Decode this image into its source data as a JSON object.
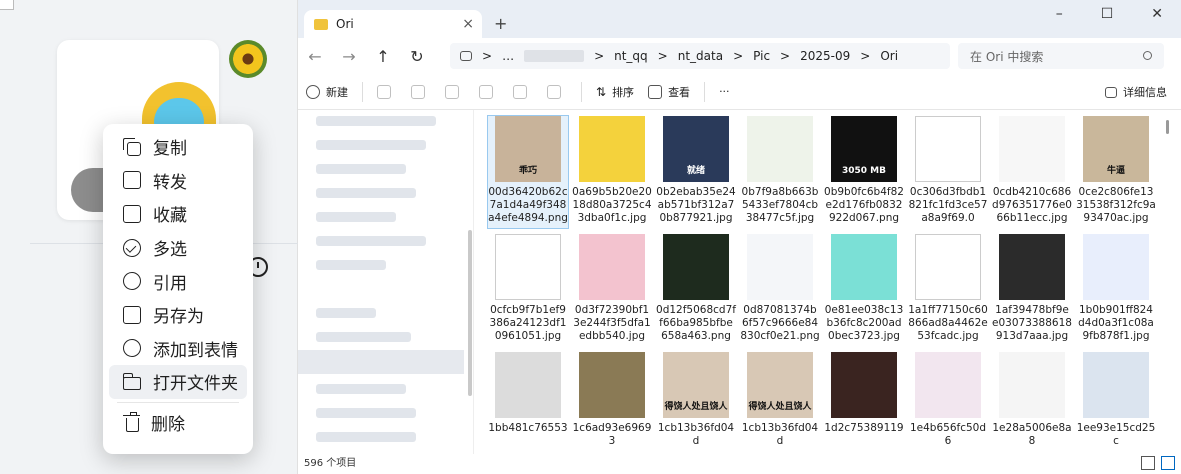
{
  "chat": {
    "menu": [
      {
        "label": "复制",
        "icon": "copy-icon"
      },
      {
        "label": "转发",
        "icon": "forward-icon"
      },
      {
        "label": "收藏",
        "icon": "star-icon"
      },
      {
        "label": "多选",
        "icon": "check-circle-icon"
      },
      {
        "label": "引用",
        "icon": "quote-icon"
      },
      {
        "label": "另存为",
        "icon": "save-as-icon"
      },
      {
        "label": "添加到表情",
        "icon": "emoji-add-icon"
      },
      {
        "label": "打开文件夹",
        "icon": "folder-icon",
        "active": true
      },
      {
        "label": "删除",
        "icon": "trash-icon"
      }
    ]
  },
  "explorer": {
    "tab_title": "Ori",
    "tab_close": "×",
    "tab_add": "+",
    "window": {
      "minimize": "–",
      "maximize": "☐",
      "close": "✕"
    },
    "nav": {
      "back": "←",
      "forward": "→",
      "up": "↑",
      "refresh": "↻"
    },
    "breadcrumb": [
      ">",
      "…",
      ">",
      "nt_qq",
      ">",
      "nt_data",
      ">",
      "Pic",
      ">",
      "2025-09",
      ">",
      "Ori"
    ],
    "search_placeholder": "在 Ori 中搜索",
    "toolbar": {
      "new": "新建",
      "sort": "排序",
      "view": "查看",
      "more": "···",
      "details": "详细信息"
    },
    "files": [
      {
        "name": "00d36420b62c7a1d4a49f348a4efe4894.png",
        "thumb": "#c8b39a",
        "caption": "乖巧",
        "selected": true
      },
      {
        "name": "0a69b5b20e2018d80a3725c43dba0f1c.jpg",
        "thumb": "#f4d23c"
      },
      {
        "name": "0b2ebab35e24ab571bf312a70b877921.jpg",
        "thumb": "#2a3a5a",
        "caption": "就绪"
      },
      {
        "name": "0b7f9a8b663b5433ef7804cb38477c5f.jpg",
        "thumb": "#eef3ea"
      },
      {
        "name": "0b9b0fc6b4f82e2d176fb0832922d067.png",
        "thumb": "#111111",
        "caption": "3050 MB"
      },
      {
        "name": "0c306d3fbdb1821fc1fd3ce57a8a9f69.0",
        "thumb": "#ffffff"
      },
      {
        "name": "0cdb4210c686d976351776e066b11ecc.jpg",
        "thumb": "#f7f7f7"
      },
      {
        "name": "0ce2c806fe1331538f312fc9a93470ac.jpg",
        "thumb": "#c9b79b",
        "caption": "牛逼"
      },
      {
        "name": "0cfcb9f7b1ef9386a24123df10961051.jpg",
        "thumb": "#ffffff"
      },
      {
        "name": "0d3f72390bf13e244f3f5dfa1edbb540.jpg",
        "thumb": "#f3c3cf"
      },
      {
        "name": "0d12f5068cd7ff66ba985bfbe658a463.png",
        "thumb": "#1e2b1e"
      },
      {
        "name": "0d87081374b6f57c9666e84830cf0e21.png",
        "thumb": "#f4f6f9"
      },
      {
        "name": "0e81ee038c13b36fc8c200ad0bec3723.jpg",
        "thumb": "#7be0d6"
      },
      {
        "name": "1a1ff77150c60866ad8a4462e53fcadc.jpg",
        "thumb": "#ffffff"
      },
      {
        "name": "1af39478bf9ee03073388618913d7aaa.jpg",
        "thumb": "#2b2b2b"
      },
      {
        "name": "1b0b901ff824d4d0a3f1c08a9fb878f1.jpg",
        "thumb": "#e8eefc"
      },
      {
        "name": "1bb481c76553",
        "thumb": "#dcdcdc"
      },
      {
        "name": "1c6ad93e69693",
        "thumb": "#8a7a55"
      },
      {
        "name": "1cb13b36fd04d",
        "thumb": "#d8c8b5",
        "caption": "得饶人处且饶人"
      },
      {
        "name": "1cb13b36fd04d",
        "thumb": "#d8c8b5",
        "caption": "得饶人处且饶人"
      },
      {
        "name": "1d2c75389119",
        "thumb": "#3a2420"
      },
      {
        "name": "1e4b656fc50d6",
        "thumb": "#f2e6ef"
      },
      {
        "name": "1e28a5006e8a8",
        "thumb": "#f5f5f5"
      },
      {
        "name": "1ee93e15cd25c",
        "thumb": "#dbe4ef"
      }
    ],
    "status": "596 个项目"
  },
  "colors": {
    "accent": "#0067c0",
    "selection": "#e5f1fb"
  }
}
